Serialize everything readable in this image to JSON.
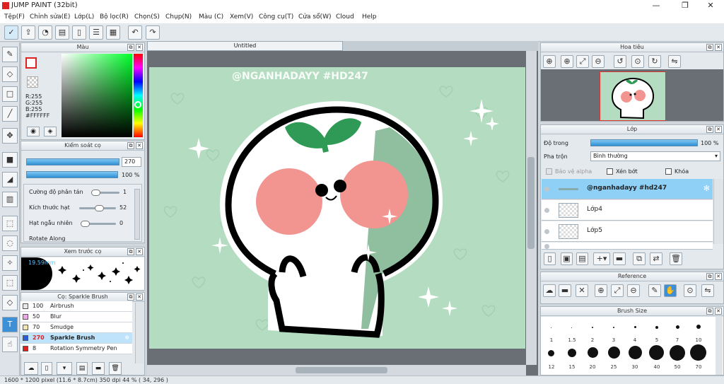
{
  "window": {
    "title": "JUMP PAINT (32bit)",
    "minimize": "—",
    "restore": "❐",
    "close": "✕"
  },
  "menu": [
    "Tệp(F)",
    "Chỉnh sửa(E)",
    "Lớp(L)",
    "Bộ lọc(R)",
    "Chọn(S)",
    "Chụp(N)",
    "Màu (C)",
    "Xem(V)",
    "Công cụ(T)",
    "Cửa sổ(W)",
    "Cloud",
    "Help"
  ],
  "color_panel": {
    "title": "Màu",
    "r": "R:255",
    "g": "G:255",
    "b": "B:255",
    "hex": "#FFFFFF"
  },
  "brush_control": {
    "title": "Kiểm soát cọ",
    "size_value": "270",
    "opacity_value": "100 %",
    "scatter_label": "Cường độ phân tán",
    "scatter_value": "1",
    "particle_label": "Kích thước hạt",
    "particle_value": "52",
    "random_label": "Hạt ngẫu nhiên",
    "random_value": "0",
    "rotate_label": "Rotate Along"
  },
  "brush_preview": {
    "title": "Xem trước cọ",
    "size_label": "19.59mm"
  },
  "brush_list": {
    "title": "Cọ: Sparkle Brush",
    "items": [
      {
        "size": "100",
        "name": "Airbrush",
        "color": "#e8e8e8"
      },
      {
        "size": "50",
        "name": "Blur",
        "color": "#f0a8e8"
      },
      {
        "size": "70",
        "name": "Smudge",
        "color": "#f2e6b0"
      },
      {
        "size": "270",
        "name": "Sparkle Brush",
        "color": "#2b5fd9"
      },
      {
        "size": "8",
        "name": "Rotation Symmetry Pen",
        "color": "#e02020"
      }
    ]
  },
  "canvas": {
    "tab": "Untitled",
    "watermark": "@NGANHADAYY #HD247"
  },
  "navigator": {
    "title": "Hoa tiêu"
  },
  "layer_panel": {
    "title": "Lớp",
    "opacity_label": "Độ trong",
    "opacity_value": "100 %",
    "blend_label": "Pha trộn",
    "blend_value": "Bình thường",
    "protect_alpha": "Bảo vệ alpha",
    "clipping": "Xén bớt",
    "lock": "Khóa",
    "layers": [
      "@nganhadayy #hd247",
      "Lớp4",
      "Lớp5"
    ]
  },
  "reference": {
    "title": "Reference"
  },
  "brush_size": {
    "title": "Brush Size",
    "row1": [
      "1",
      "1.5",
      "2",
      "3",
      "4",
      "5",
      "7",
      "10"
    ],
    "row2": [
      "12",
      "15",
      "20",
      "25",
      "30",
      "40",
      "50",
      "70"
    ]
  },
  "status": "1600 * 1200 pixel   (11.6 * 8.7cm)   350 dpi   44 %   ( 34, 296 )",
  "colors": {
    "accent": "#2f8fd3",
    "canvas_bg": "#b4dcc0",
    "cheek": "#f2948f",
    "leaf": "#2e9a55"
  }
}
